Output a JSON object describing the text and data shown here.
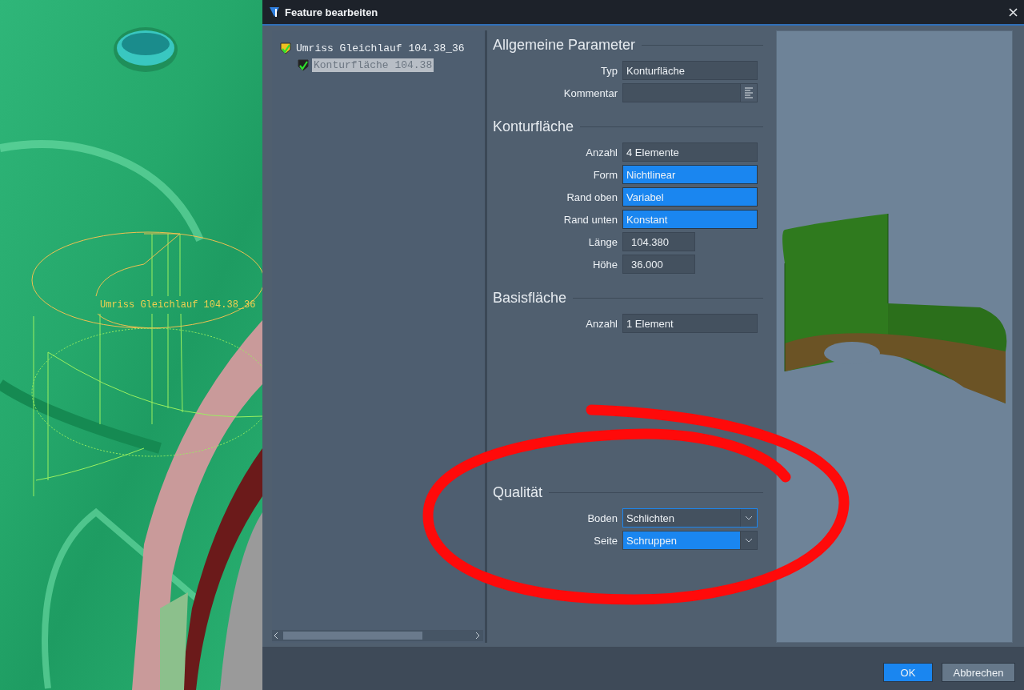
{
  "viewport": {
    "label": "Umriss Gleichlauf 104.38_36"
  },
  "window": {
    "title": "Feature bearbeiten"
  },
  "tree": [
    {
      "label": "Umriss Gleichlauf 104.38_36",
      "selected": false,
      "children": [
        {
          "label": "Konturfläche 104.38",
          "selected": true
        }
      ]
    }
  ],
  "sections": [
    {
      "title": "Allgemeine Parameter",
      "fields": [
        {
          "label": "Typ",
          "kind": "text",
          "value": "Konturfläche",
          "highlighted": false
        },
        {
          "label": "Kommentar",
          "kind": "memo",
          "highlighted": false
        }
      ]
    },
    {
      "title": "Konturfläche",
      "fields": [
        {
          "label": "Anzahl",
          "kind": "text",
          "value": "4 Elemente",
          "highlighted": false
        },
        {
          "label": "Form",
          "kind": "text",
          "value": "Nichtlinear",
          "highlighted": true
        },
        {
          "label": "Rand oben",
          "kind": "text",
          "value": "Variabel",
          "highlighted": true
        },
        {
          "label": "Rand unten",
          "kind": "text",
          "value": "Konstant",
          "highlighted": true
        },
        {
          "label": "Länge",
          "kind": "number",
          "value": "104.380",
          "highlighted": false
        },
        {
          "label": "Höhe",
          "kind": "number",
          "value": "36.000",
          "highlighted": false
        }
      ]
    },
    {
      "title": "Basisfläche",
      "fields": [
        {
          "label": "Anzahl",
          "kind": "text",
          "value": "1 Element",
          "highlighted": false
        }
      ]
    },
    {
      "title": "Qualität",
      "fields": [
        {
          "label": "Boden",
          "kind": "combo",
          "value": "Schlichten",
          "highlighted": false,
          "focused": true
        },
        {
          "label": "Seite",
          "kind": "combo",
          "value": "Schruppen",
          "highlighted": true,
          "focused": false
        }
      ]
    }
  ],
  "buttons": [
    {
      "label": "OK",
      "kind": "primary"
    },
    {
      "label": "Abbrechen",
      "kind": "secondary"
    }
  ]
}
